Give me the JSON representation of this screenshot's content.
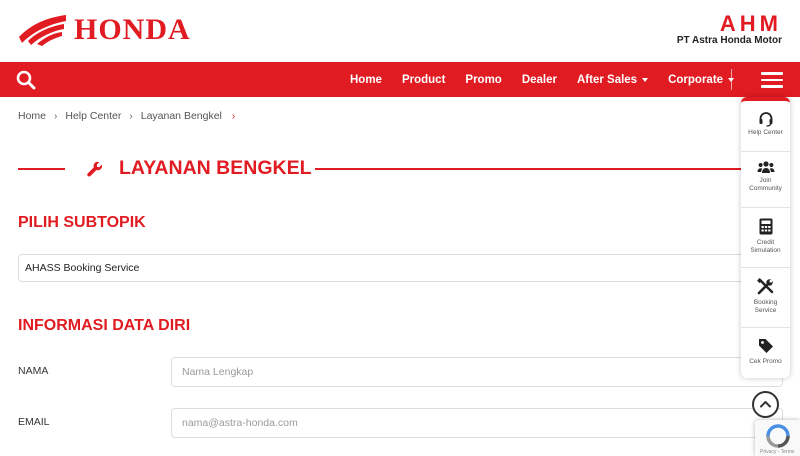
{
  "brand": {
    "name": "HONDA",
    "ahm_logo": "AHM",
    "ahm_subtitle": "PT Astra Honda Motor",
    "accent": "#e11b22"
  },
  "nav": {
    "search_icon": "search-icon",
    "items": [
      {
        "label": "Home",
        "dropdown": false
      },
      {
        "label": "Product",
        "dropdown": false
      },
      {
        "label": "Promo",
        "dropdown": false
      },
      {
        "label": "Dealer",
        "dropdown": false
      },
      {
        "label": "After Sales",
        "dropdown": true
      },
      {
        "label": "Corporate",
        "dropdown": true
      }
    ],
    "menu_icon": "hamburger-menu-icon"
  },
  "breadcrumb": [
    "Home",
    "Help Center",
    "Layanan Bengkel"
  ],
  "page": {
    "title": "LAYANAN BENGKEL",
    "title_icon": "wrench-icon",
    "subtopic_heading": "PILIH SUBTOPIK",
    "subtopic_value": "AHASS Booking Service",
    "personal_heading": "INFORMASI DATA DIRI",
    "fields": {
      "name_label": "NAMA",
      "name_placeholder": "Nama Lengkap",
      "email_label": "EMAIL",
      "email_placeholder": "nama@astra-honda.com"
    }
  },
  "side_panel": {
    "items": [
      {
        "label": "Help Center",
        "icon": "headset-icon"
      },
      {
        "label": "Join Community",
        "icon": "community-icon"
      },
      {
        "label": "Credit Simulation",
        "icon": "calculator-icon"
      },
      {
        "label": "Booking Service",
        "icon": "tools-icon"
      },
      {
        "label": "Cek Promo",
        "icon": "tag-icon"
      }
    ]
  },
  "scroll_top_icon": "chevron-up-icon",
  "recaptcha": {
    "terms": "Privacy - Terms"
  }
}
